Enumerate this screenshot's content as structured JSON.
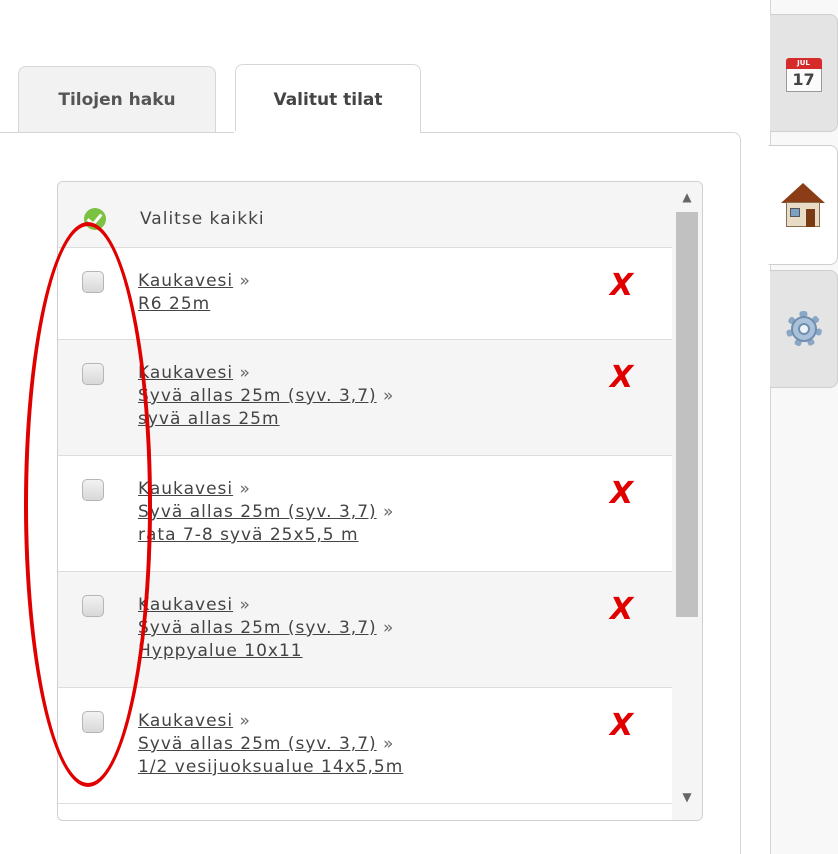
{
  "tabs": {
    "search_label": "Tilojen haku",
    "selected_label": "Valitut tilat"
  },
  "list": {
    "select_all_label": "Valitse kaikki",
    "items": [
      {
        "lines": [
          {
            "text": "Kaukavesi",
            "sep": "»"
          },
          {
            "text": "R6 25m",
            "sep": ""
          }
        ]
      },
      {
        "lines": [
          {
            "text": "Kaukavesi",
            "sep": "»"
          },
          {
            "text": "Syvä allas 25m (syv. 3,7)",
            "sep": "»"
          },
          {
            "text": "syvä allas 25m",
            "sep": ""
          }
        ]
      },
      {
        "lines": [
          {
            "text": "Kaukavesi",
            "sep": "»"
          },
          {
            "text": "Syvä allas 25m (syv. 3,7)",
            "sep": "»"
          },
          {
            "text": "rata 7-8 syvä 25x5,5 m",
            "sep": ""
          }
        ]
      },
      {
        "lines": [
          {
            "text": "Kaukavesi",
            "sep": "»"
          },
          {
            "text": "Syvä allas 25m (syv. 3,7)",
            "sep": "»"
          },
          {
            "text": "Hyppyalue 10x11",
            "sep": ""
          }
        ]
      },
      {
        "lines": [
          {
            "text": "Kaukavesi",
            "sep": "»"
          },
          {
            "text": "Syvä allas 25m (syv. 3,7)",
            "sep": "»"
          },
          {
            "text": "1/2 vesijuoksualue 14x5,5m",
            "sep": ""
          }
        ]
      }
    ],
    "delete_glyph": "X"
  },
  "scrollbar": {
    "up_glyph": "^",
    "down_glyph": "v"
  },
  "sidebar": {
    "calendar": {
      "month": "JUL",
      "day": "17",
      "icon": "calendar-icon"
    },
    "home": {
      "icon": "house-icon"
    },
    "settings": {
      "icon": "gear-icon"
    }
  },
  "colors": {
    "delete": "#e00000",
    "check": "#7cc242",
    "annotation": "#e00000"
  }
}
